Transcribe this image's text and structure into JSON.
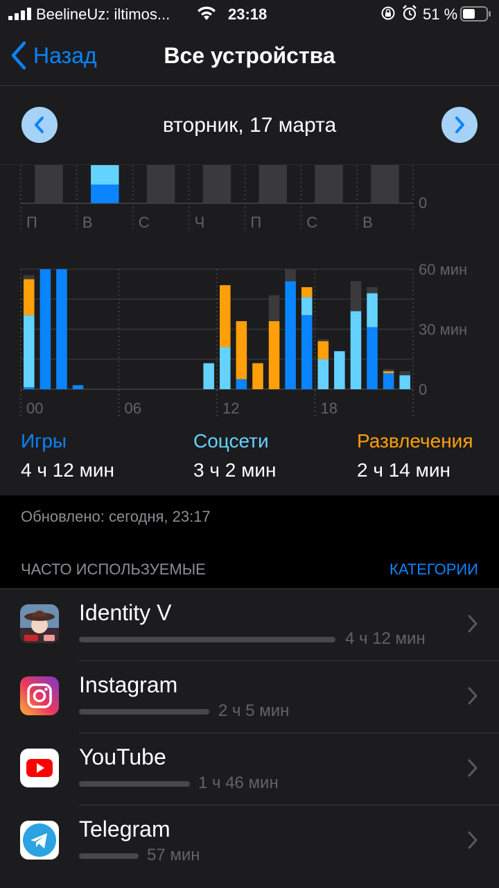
{
  "status": {
    "carrier": "BeelineUz: iltimos...",
    "time": "23:18",
    "battery": "51 %"
  },
  "nav": {
    "back_label": "Назад",
    "title": "Все устройства"
  },
  "date": {
    "label": "вторник, 17 марта"
  },
  "colors": {
    "games": "#0a84ff",
    "social": "#64d2ff",
    "entertainment": "#ff9f0a",
    "other": "#3a3a3c"
  },
  "chart_data": [
    {
      "type": "bar",
      "title": "",
      "categories": [
        "П",
        "В",
        "С",
        "Ч",
        "П",
        "С",
        "В"
      ],
      "y_axis_labels": [
        "0"
      ],
      "selected_index": 1,
      "note": "top of weekly chart scrolled out of view"
    },
    {
      "type": "bar",
      "stacked": true,
      "title": "",
      "x_tick_labels": [
        "00",
        "06",
        "12",
        "18"
      ],
      "y_tick_labels": [
        "60 мин",
        "30 мин",
        "0"
      ],
      "ylim": [
        0,
        60
      ],
      "hours": [
        0,
        1,
        2,
        3,
        4,
        5,
        6,
        7,
        8,
        9,
        10,
        11,
        12,
        13,
        14,
        15,
        16,
        17,
        18,
        19,
        20,
        21,
        22,
        23
      ],
      "series": [
        {
          "name": "Игры",
          "values": [
            1,
            60,
            60,
            2,
            0,
            0,
            0,
            0,
            0,
            0,
            0,
            0,
            0,
            5,
            0,
            0,
            54,
            37,
            0,
            0,
            0,
            31,
            8,
            0
          ]
        },
        {
          "name": "Соцсети",
          "values": [
            36,
            0,
            0,
            0,
            0,
            0,
            0,
            0,
            0,
            0,
            0,
            13,
            21,
            0,
            0,
            0,
            0,
            9,
            15,
            19,
            39,
            17,
            0,
            7
          ]
        },
        {
          "name": "Развлечения",
          "values": [
            18,
            0,
            0,
            0,
            0,
            0,
            0,
            0,
            0,
            0,
            0,
            0,
            31,
            29,
            13,
            34,
            0,
            5,
            9,
            0,
            0,
            0,
            1,
            0
          ]
        },
        {
          "name": "",
          "values": [
            2,
            0,
            0,
            0,
            0,
            0,
            0,
            0,
            0,
            0,
            0,
            0,
            0,
            0,
            0,
            13,
            6,
            0,
            1,
            0,
            15,
            3,
            1,
            2
          ]
        }
      ]
    }
  ],
  "categories": [
    {
      "name": "Игры",
      "value": "4 ч 12 мин",
      "color": "#0a84ff"
    },
    {
      "name": "Соцсети",
      "value": "3 ч 2 мин",
      "color": "#64d2ff"
    },
    {
      "name": "Развлечения",
      "value": "2 ч 14 мин",
      "color": "#ff9f0a"
    }
  ],
  "updated": "Обновлено: сегодня, 23:17",
  "section": {
    "title": "ЧАСТО ИСПОЛЬЗУЕМЫЕ",
    "link": "КАТЕГОРИИ"
  },
  "apps": [
    {
      "name": "Identity V",
      "usage": "4 ч 12 мин",
      "minutes": 252,
      "icon": "identity-v-icon"
    },
    {
      "name": "Instagram",
      "usage": "2 ч 5 мин",
      "minutes": 125,
      "icon": "instagram-icon"
    },
    {
      "name": "YouTube",
      "usage": "1 ч 46 мин",
      "minutes": 106,
      "icon": "youtube-icon"
    },
    {
      "name": "Telegram",
      "usage": "57 мин",
      "minutes": 57,
      "icon": "telegram-icon"
    }
  ]
}
